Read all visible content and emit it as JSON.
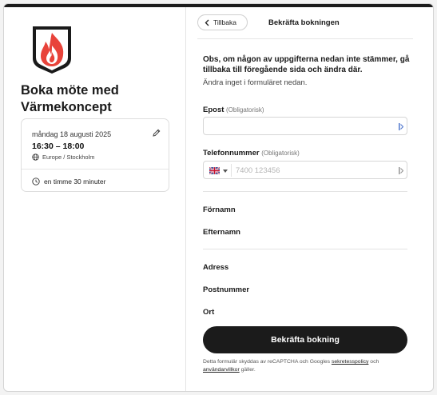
{
  "left": {
    "title": "Boka möte med Värmekoncept",
    "date": "måndag 18 augusti 2025",
    "time": "16:30 – 18:00",
    "timezone": "Europe / Stockholm",
    "duration": "en timme 30 minuter"
  },
  "header": {
    "back_label": "Tillbaka",
    "title": "Bekräfta bokningen"
  },
  "notice": {
    "bold": "Obs, om någon av uppgifterna nedan inte stämmer, gå tillbaka till föregående sida och ändra där.",
    "sub": "Ändra inget i formuläret nedan."
  },
  "form": {
    "email_label": "Epost",
    "email_optional": "(Obligatorisk)",
    "email_value": "",
    "phone_label": "Telefonnummer",
    "phone_optional": "(Obligatorisk)",
    "phone_placeholder": "7400 123456",
    "firstname_label": "Förnamn",
    "lastname_label": "Efternamn",
    "address_label": "Adress",
    "postcode_label": "Postnummer",
    "city_label": "Ort"
  },
  "confirm_label": "Bekräfta bokning",
  "legal": {
    "prefix": "Detta formulär skyddas av reCAPTCHA och Googles",
    "privacy": "sekretesspolicy",
    "and": "och",
    "terms": "användarvillkor",
    "suffix": "gäller."
  },
  "colors": {
    "accent": "#1b1b1b",
    "logo_flame": "#e8433a",
    "logo_shield": "#1a1a1a"
  }
}
